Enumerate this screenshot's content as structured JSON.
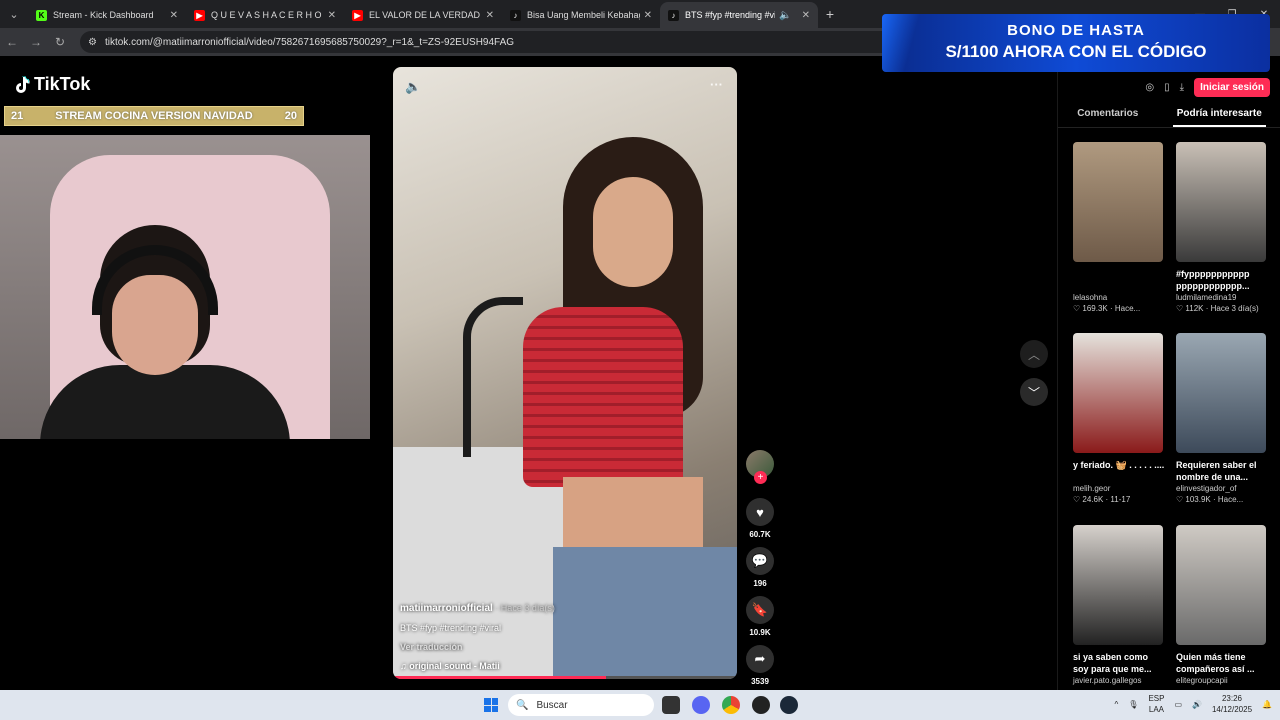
{
  "tabs": [
    {
      "title": "Stream - Kick Dashboard",
      "fav_color": "#53fc18",
      "fav_glyph": "K"
    },
    {
      "title": "Q U E V A S H A C E R H O Y ?",
      "fav_color": "#ff0000",
      "fav_glyph": "▶"
    },
    {
      "title": "EL VALOR DE LA VERDAD DE TI",
      "fav_color": "#ff0000",
      "fav_glyph": "▶"
    },
    {
      "title": "Bisa Uang Membeli Kebahagia",
      "fav_color": "#111111",
      "fav_glyph": "♪"
    },
    {
      "title": "BTS #fyp #trending #viral |",
      "fav_color": "#111111",
      "fav_glyph": "♪"
    }
  ],
  "address": {
    "url": "tiktok.com/@matiimarroniofficial/video/7582671695685750029?_r=1&_t=ZS-92EUSH94FAG"
  },
  "ad": {
    "line1": "BONO DE HASTA",
    "line2": "S/1100 AHORA CON EL CÓDIGO"
  },
  "page": {
    "logo": "TikTok",
    "stream_overlay": {
      "left": "21",
      "title": "STREAM COCINA VERSION NAVIDAD",
      "right": "20"
    },
    "login": "Iniciar sesión"
  },
  "video": {
    "author": "matiimarroniofficial",
    "when": " · Hace 3 día(s)",
    "caption": "BTS #fyp #trending #viral",
    "translate": "Ver traducción",
    "sound": "original sound - Matii",
    "progress": 0.62
  },
  "actions": {
    "likes": "60.7K",
    "comments": "196",
    "saves": "10.9K",
    "shares": "3539"
  },
  "panel_tabs": [
    "Comentarios",
    "Podría interesarte"
  ],
  "recommended": [
    {
      "caption": "",
      "author": "lelasohna",
      "stats": "♡ 169.3K · Hace...",
      "colors": [
        "#b09a80",
        "#6e5a48"
      ]
    },
    {
      "caption": "#fyppppppppppp pppppppppppp...",
      "author": "ludmilamedina19",
      "stats": "♡ 112K · Hace 3 día(s)",
      "colors": [
        "#c9c0b6",
        "#3a3a3a"
      ]
    },
    {
      "caption": "y feriado. 🧺 . . . . . ....",
      "author": "melih.geor",
      "stats": "♡ 24.6K · 11-17",
      "colors": [
        "#e5e2dc",
        "#8a1a1a"
      ]
    },
    {
      "caption": "Requieren saber el nombre de una...",
      "author": "elinvestigador_of",
      "stats": "♡ 103.9K · Hace...",
      "colors": [
        "#9aa7b2",
        "#3d4a5a"
      ]
    },
    {
      "caption": "si ya saben como soy para que me...",
      "author": "javier.pato.gallegos",
      "stats": "",
      "colors": [
        "#d6d1cc",
        "#222222"
      ]
    },
    {
      "caption": "Quien más tiene compañeros así ...",
      "author": "elitegroupcapii",
      "stats": "",
      "colors": [
        "#cfcac4",
        "#6a6a6a"
      ]
    }
  ],
  "taskbar": {
    "search_placeholder": "Buscar",
    "lang1": "ESP",
    "lang2": "LAA",
    "time": "23:26",
    "date": "14/12/2025"
  }
}
